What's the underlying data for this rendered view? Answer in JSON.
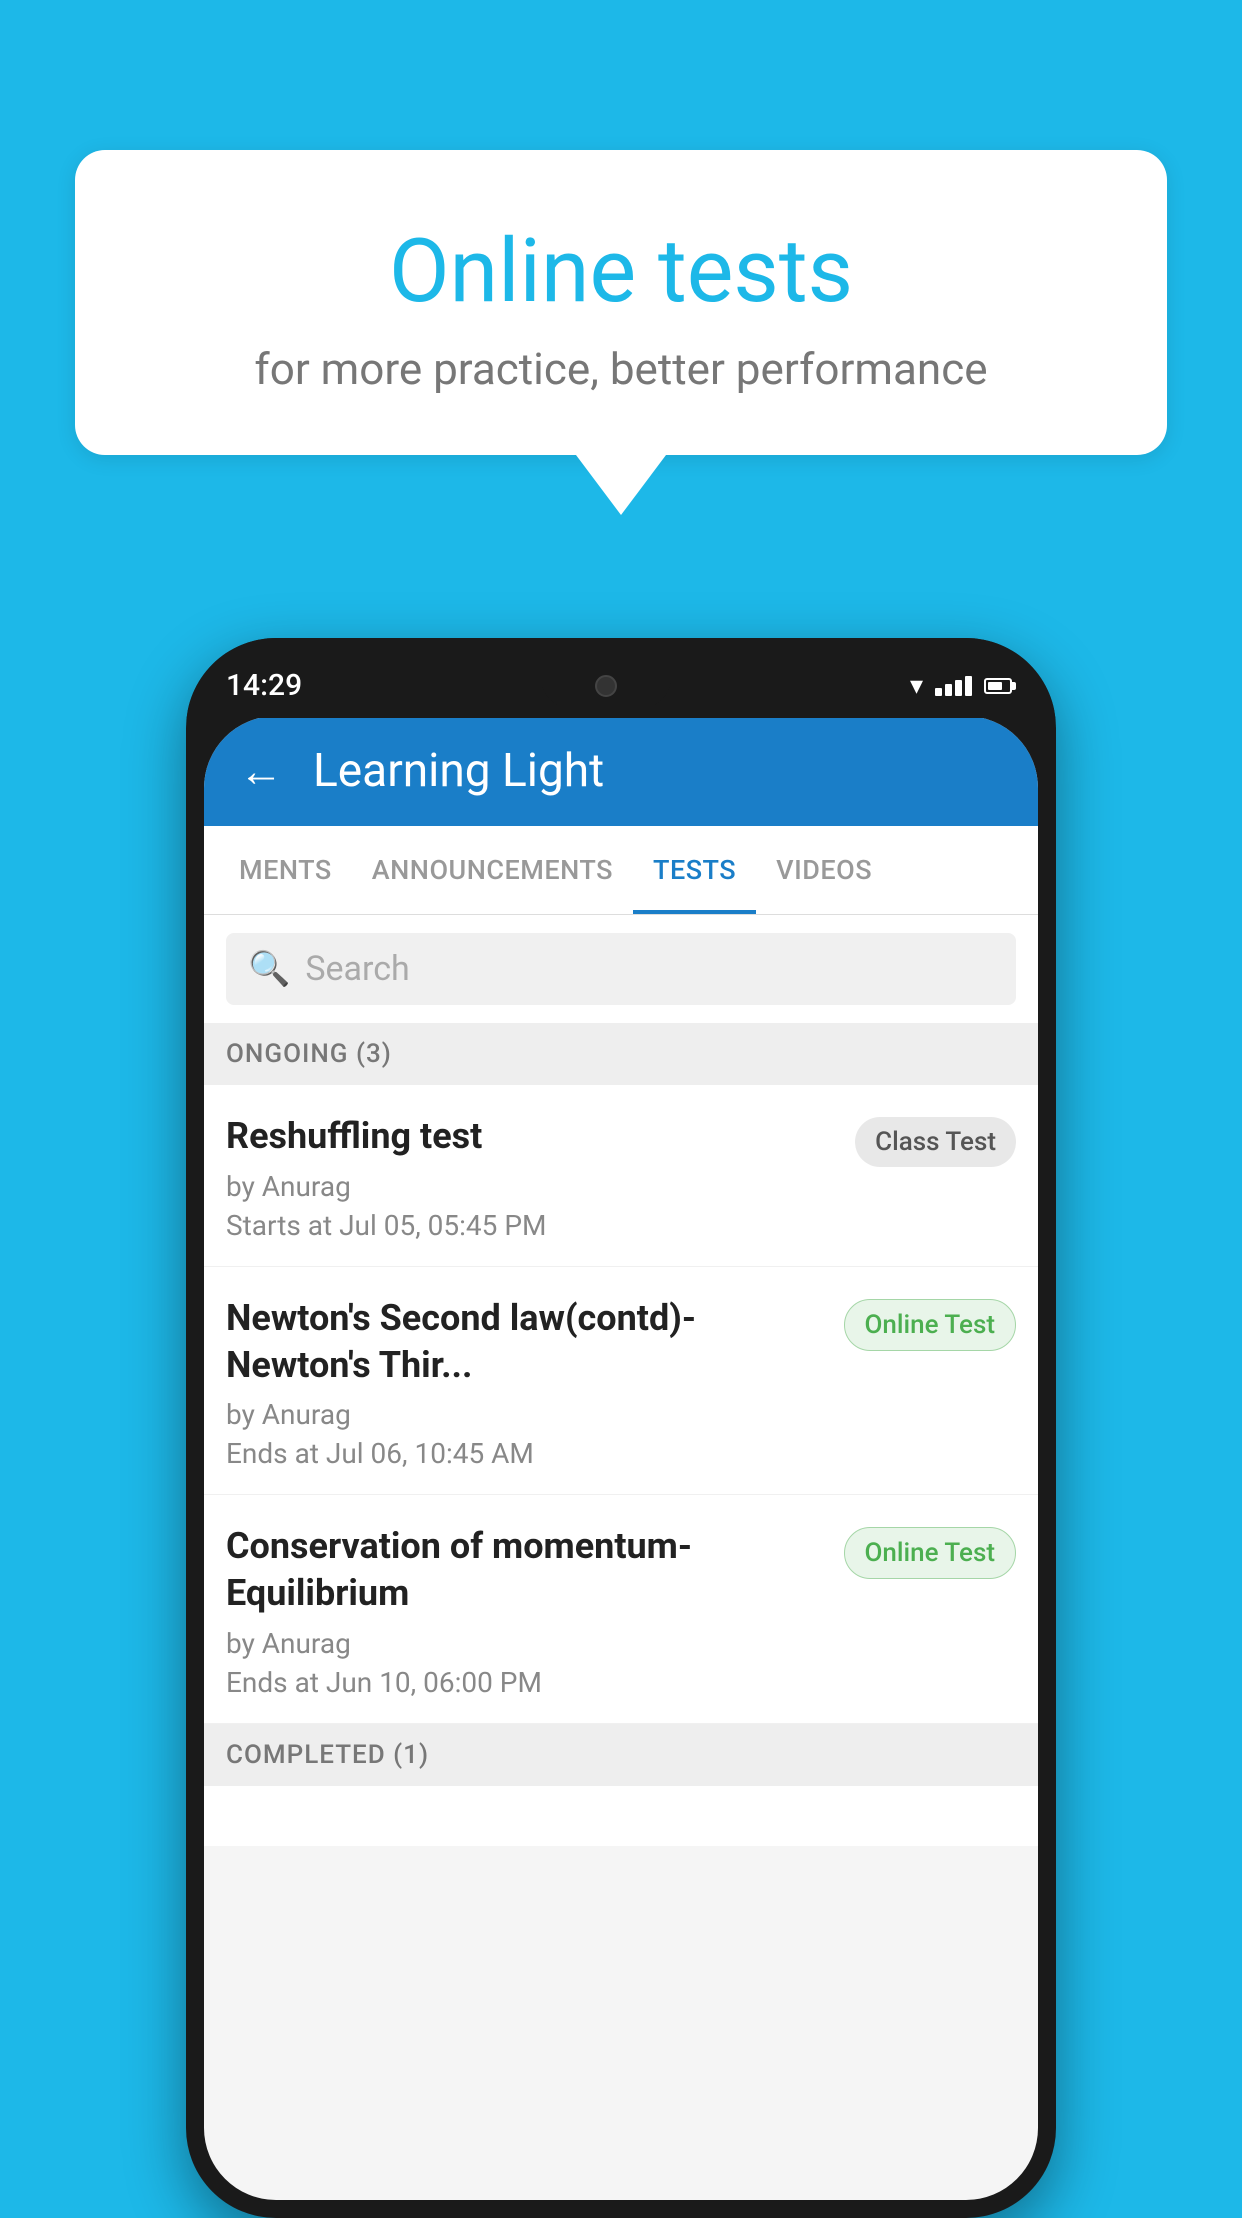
{
  "background_color": "#1DB8E8",
  "speech_bubble": {
    "title": "Online tests",
    "subtitle": "for more practice, better performance"
  },
  "phone": {
    "time": "14:29",
    "app_header": {
      "title": "Learning Light"
    },
    "tabs": [
      {
        "label": "MENTS",
        "active": false
      },
      {
        "label": "ANNOUNCEMENTS",
        "active": false
      },
      {
        "label": "TESTS",
        "active": true
      },
      {
        "label": "VIDEOS",
        "active": false
      }
    ],
    "search": {
      "placeholder": "Search"
    },
    "ongoing_section": {
      "header": "ONGOING (3)",
      "tests": [
        {
          "title": "Reshuffling test",
          "author": "by Anurag",
          "date": "Starts at  Jul 05, 05:45 PM",
          "badge": "Class Test",
          "badge_type": "class"
        },
        {
          "title": "Newton's Second law(contd)-Newton's Thir...",
          "author": "by Anurag",
          "date": "Ends at  Jul 06, 10:45 AM",
          "badge": "Online Test",
          "badge_type": "online"
        },
        {
          "title": "Conservation of momentum-Equilibrium",
          "author": "by Anurag",
          "date": "Ends at  Jun 10, 06:00 PM",
          "badge": "Online Test",
          "badge_type": "online"
        }
      ]
    },
    "completed_section": {
      "header": "COMPLETED (1)"
    }
  }
}
